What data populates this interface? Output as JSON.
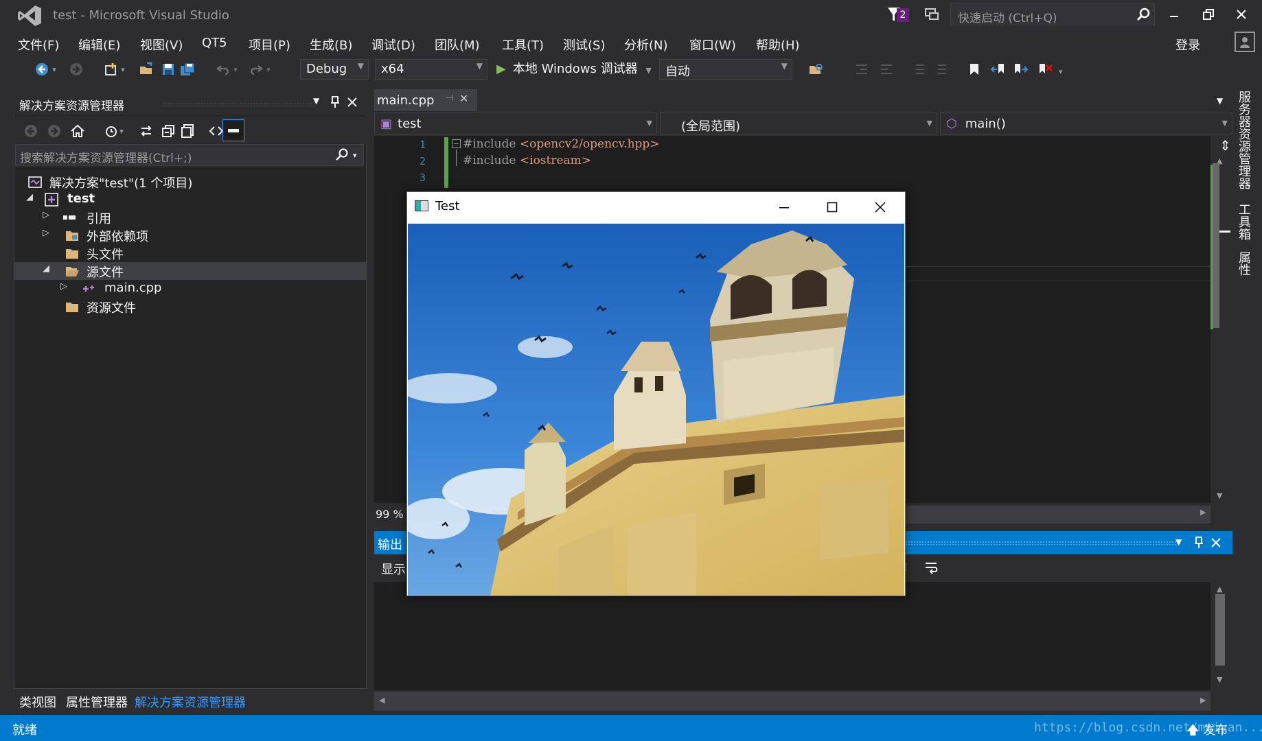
{
  "titlebar": {
    "title": "test - Microsoft Visual Studio",
    "notification_count": "2",
    "quick_launch_placeholder": "快速启动 (Ctrl+Q)"
  },
  "menu": [
    "文件(F)",
    "编辑(E)",
    "视图(V)",
    "QT5",
    "项目(P)",
    "生成(B)",
    "调试(D)",
    "团队(M)",
    "工具(T)",
    "测试(S)",
    "分析(N)",
    "窗口(W)",
    "帮助(H)"
  ],
  "signin": "登录",
  "toolbar": {
    "config": "Debug",
    "platform": "x64",
    "run_label": "本地 Windows 调试器",
    "run_mode": "自动"
  },
  "solution_explorer": {
    "title": "解决方案资源管理器",
    "search_placeholder": "搜索解决方案资源管理器(Ctrl+;)",
    "tree": [
      {
        "label": "解决方案\"test\"(1 个项目)"
      },
      {
        "label": "test"
      },
      {
        "label": "引用"
      },
      {
        "label": "外部依赖项"
      },
      {
        "label": "头文件"
      },
      {
        "label": "源文件"
      },
      {
        "label": "main.cpp"
      },
      {
        "label": "资源文件"
      }
    ],
    "bottom_tabs": [
      "类视图",
      "属性管理器",
      "解决方案资源管理器"
    ]
  },
  "editor": {
    "tab": "main.cpp",
    "nav_project": "test",
    "nav_scope": "(全局范围)",
    "nav_member": "main()",
    "line_numbers": [
      "1",
      "2",
      "3"
    ],
    "lines": [
      {
        "directive": "#include ",
        "arg": "<opencv2/opencv.hpp>"
      },
      {
        "directive": "#include ",
        "arg": "<iostream>"
      }
    ],
    "zoom": "99 %"
  },
  "output": {
    "title": "输出",
    "show_label": "显示"
  },
  "right_sidebar": [
    "服务器资源管理器",
    "工具箱",
    "属性"
  ],
  "statusbar": {
    "status": "就绪",
    "publish": "发布",
    "watermark": "https://blog.csdn.net/maiyan..."
  },
  "cv_window": {
    "title": "Test"
  },
  "colors": {
    "accent": "#007acc",
    "background": "#2d2d30",
    "editor_bg": "#1e1e1e",
    "string": "#d69d85"
  }
}
